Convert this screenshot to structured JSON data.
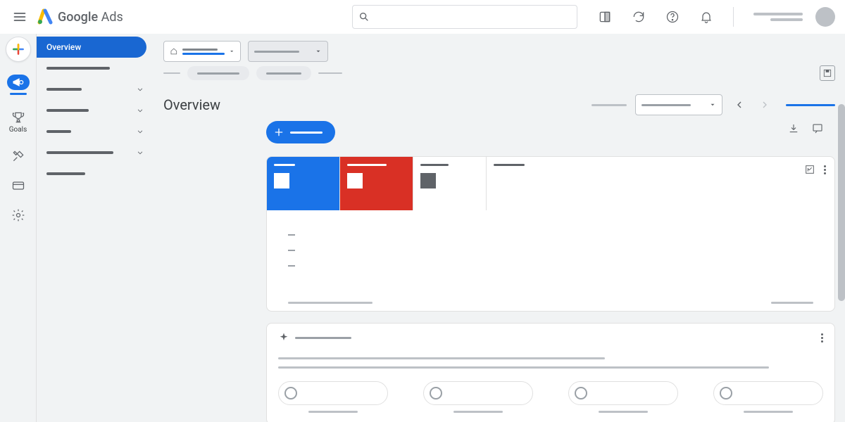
{
  "header": {
    "product_bold": "Google",
    "product_sub": "Ads"
  },
  "sidenav": {
    "active_label": "Overview"
  },
  "leftrail": {
    "goals_label": "Goals"
  },
  "main": {
    "title": "Overview"
  }
}
